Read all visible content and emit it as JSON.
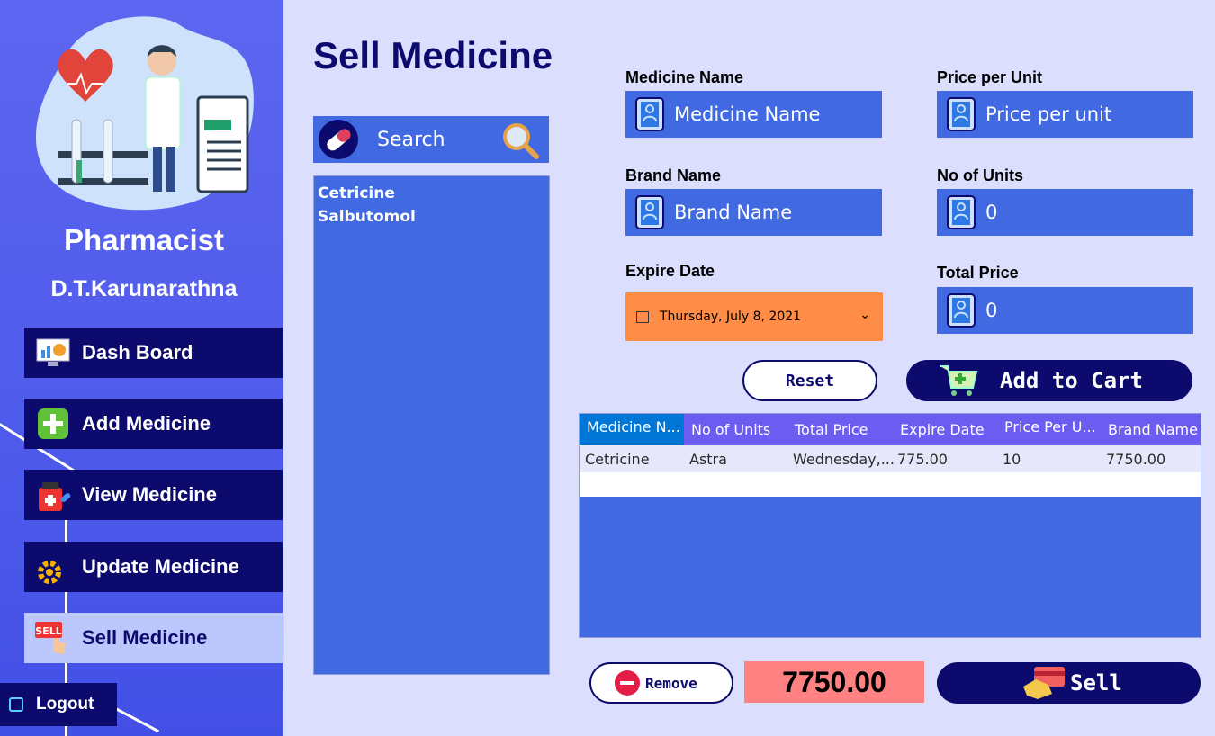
{
  "sidebar": {
    "role": "Pharmacist",
    "user": "D.T.Karunarathna",
    "items": [
      {
        "label": "Dash Board",
        "icon": "dashboard-icon"
      },
      {
        "label": "Add Medicine",
        "icon": "add-icon"
      },
      {
        "label": "View Medicine",
        "icon": "view-medicine-icon"
      },
      {
        "label": "Update Medicine",
        "icon": "gear-icon"
      },
      {
        "label": "Sell Medicine",
        "icon": "sell-icon"
      }
    ],
    "logout": "Logout"
  },
  "main": {
    "title": "Sell Medicine",
    "search": {
      "placeholder": "Search"
    },
    "medicine_list": [
      "Cetricine",
      "Salbutomol"
    ],
    "form": {
      "medicine_name": {
        "label": "Medicine Name",
        "placeholder": "Medicine Name"
      },
      "price_per_unit": {
        "label": "Price per Unit",
        "placeholder": "Price per unit"
      },
      "brand_name": {
        "label": "Brand Name",
        "placeholder": "Brand Name"
      },
      "no_of_units": {
        "label": "No of Units",
        "value": "0"
      },
      "expire_date": {
        "label": "Expire Date",
        "value": "Thursday, July 8, 2021"
      },
      "total_price": {
        "label": "Total Price",
        "value": "0"
      }
    },
    "reset_label": "Reset",
    "add_to_cart_label": "Add to Cart",
    "cart": {
      "columns": [
        "Medicine N...",
        "No of Units",
        "Total Price",
        "Expire Date",
        "Price Per U...",
        "Brand Name"
      ],
      "rows": [
        [
          "Cetricine",
          "Astra",
          "Wednesday,...",
          "775.00",
          "10",
          "7750.00"
        ]
      ]
    },
    "remove_label": "Remove",
    "grand_total": "7750.00",
    "sell_label": "Sell"
  },
  "colors": {
    "navy": "#0d0a6e",
    "field_blue": "#4169e1",
    "date_orange": "#ff8c47",
    "total_pink": "#ff8181"
  }
}
